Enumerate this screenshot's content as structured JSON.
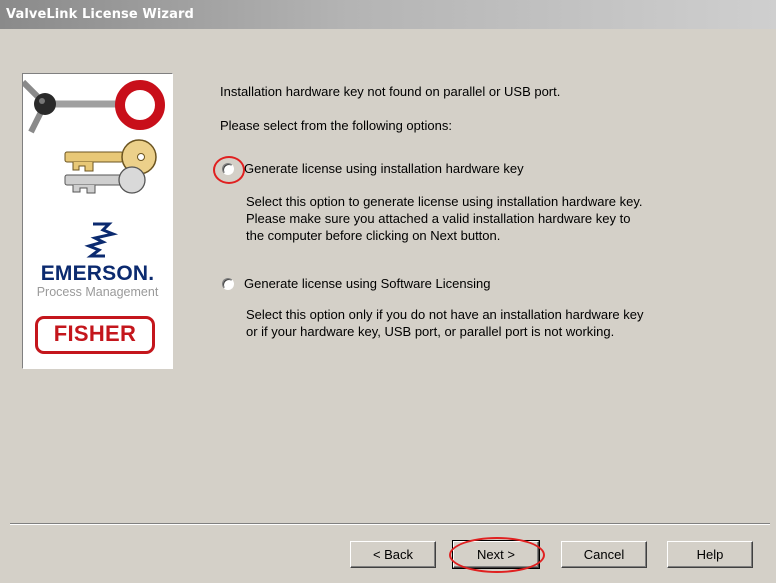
{
  "window": {
    "title": "ValveLink License Wizard"
  },
  "brand": {
    "company": "EMERSON.",
    "division": "Process Management",
    "product_brand": "FISHER"
  },
  "content": {
    "message": "Installation hardware key not found on parallel or USB port.",
    "prompt": "Please select from the following options:",
    "options": [
      {
        "label": "Generate license using installation hardware key",
        "description": [
          "Select this option to generate license using installation hardware key.",
          "Please make sure you attached a valid installation hardware key to",
          "the computer before clicking on Next button."
        ]
      },
      {
        "label": "Generate license using Software Licensing",
        "description": [
          "Select this option only if you do not have an installation hardware key",
          "or if your hardware key, USB port, or parallel port is not working."
        ]
      }
    ]
  },
  "buttons": {
    "back": "< Back",
    "next": "Next >",
    "cancel": "Cancel",
    "help": "Help"
  },
  "colors": {
    "annotation": "#e02020",
    "fisher_red": "#c4161c",
    "emerson_blue": "#0b2a6f"
  }
}
